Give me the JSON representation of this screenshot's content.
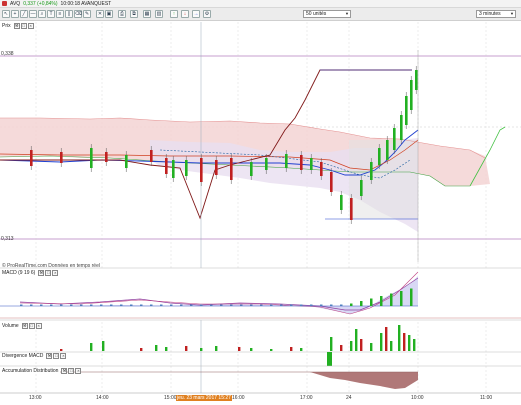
{
  "titlebar": {
    "ticker": "AVQ",
    "quote": "0,337 (+0,84%)",
    "info": "10:00:18 AVANQUEST"
  },
  "toolbar": {
    "units_select": "50 unités",
    "interval_select": "3 minutes"
  },
  "panels": {
    "price": "Prix",
    "macd": "MACD (9 19 6)",
    "volume": "Volume",
    "divergence": "Divergence MACD",
    "accumulation": "Accumulation Distribution"
  },
  "price_levels": {
    "top": "0,338",
    "bottom": "0,313"
  },
  "watermark": "© ProRealTime.com  Données en temps réel",
  "x_axis": {
    "labels": [
      "13:00",
      "14:00",
      "15:00",
      "16:00",
      "17:00",
      "24",
      "10:00",
      "11:00"
    ],
    "crosshair_label": "jeu. 23 mars 2017 15:27"
  },
  "colors": {
    "bull": "#22b022",
    "bear": "#c02020",
    "cloud_top": "#f0c8c8",
    "cloud_bottom": "#e4d8ee",
    "kijun": "#2040d0",
    "chikou": "#801818",
    "macd_fill": "#d8d8f4"
  },
  "icons": [
    "cursor-icon",
    "crosshair-icon",
    "line-icon",
    "hline-icon",
    "zoom-icon",
    "text-icon",
    "fib-icon",
    "channel-icon",
    "eraser-icon",
    "pen-icon",
    "delete-icon",
    "save-icon",
    "print-icon",
    "table-icon",
    "green-arrow-icon",
    "red-arrow-icon",
    "buy-icon",
    "sell-icon"
  ]
}
